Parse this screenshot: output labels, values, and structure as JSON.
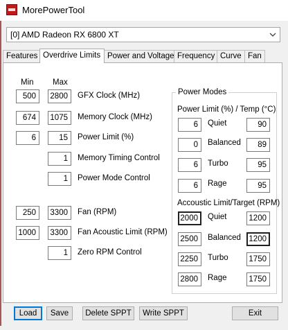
{
  "window": {
    "title": "MorePowerTool"
  },
  "gpu_select": {
    "value": "[0] AMD Radeon RX 6800 XT"
  },
  "tabs": [
    {
      "label": "Features"
    },
    {
      "label": "Overdrive Limits"
    },
    {
      "label": "Power and Voltage"
    },
    {
      "label": "Frequency"
    },
    {
      "label": "Curve"
    },
    {
      "label": "Fan"
    }
  ],
  "limits": {
    "min_header": "Min",
    "max_header": "Max",
    "gfx_clock": {
      "label": "GFX Clock (MHz)",
      "min": "500",
      "max": "2800"
    },
    "memory_clock": {
      "label": "Memory Clock (MHz)",
      "min": "674",
      "max": "1075"
    },
    "power_limit": {
      "label": "Power Limit (%)",
      "min": "6",
      "max": "15"
    },
    "memory_timing": {
      "label": "Memory Timing Control",
      "value": "1"
    },
    "power_mode": {
      "label": "Power Mode Control",
      "value": "1"
    },
    "fan": {
      "label": "Fan (RPM)",
      "min": "250",
      "max": "3300"
    },
    "fan_acoustic": {
      "label": "Fan Acoustic Limit (RPM)",
      "min": "1000",
      "max": "3300"
    },
    "zero_rpm": {
      "label": "Zero RPM Control",
      "value": "1"
    }
  },
  "power_modes": {
    "title": "Power Modes",
    "power_temp_header": "Power Limit (%) / Temp (°C)",
    "power_rows": [
      {
        "name": "Quiet",
        "power": "6",
        "temp": "90"
      },
      {
        "name": "Balanced",
        "power": "0",
        "temp": "89"
      },
      {
        "name": "Turbo",
        "power": "6",
        "temp": "95"
      },
      {
        "name": "Rage",
        "power": "6",
        "temp": "95"
      }
    ],
    "acoustic_header": "Accoustic Limit/Target (RPM)",
    "acoustic_rows": [
      {
        "name": "Quiet",
        "limit": "2000",
        "target": "1200"
      },
      {
        "name": "Balanced",
        "limit": "2500",
        "target": "1200"
      },
      {
        "name": "Turbo",
        "limit": "2250",
        "target": "1750"
      },
      {
        "name": "Rage",
        "limit": "2800",
        "target": "1750"
      }
    ]
  },
  "buttons": {
    "load": "Load",
    "save": "Save",
    "delete_sppt": "Delete SPPT",
    "write_sppt": "Write SPPT",
    "exit": "Exit"
  },
  "colors": {
    "accent": "#0078d7",
    "app_icon": "#c41919",
    "window_bg": "#f0f0f0"
  }
}
